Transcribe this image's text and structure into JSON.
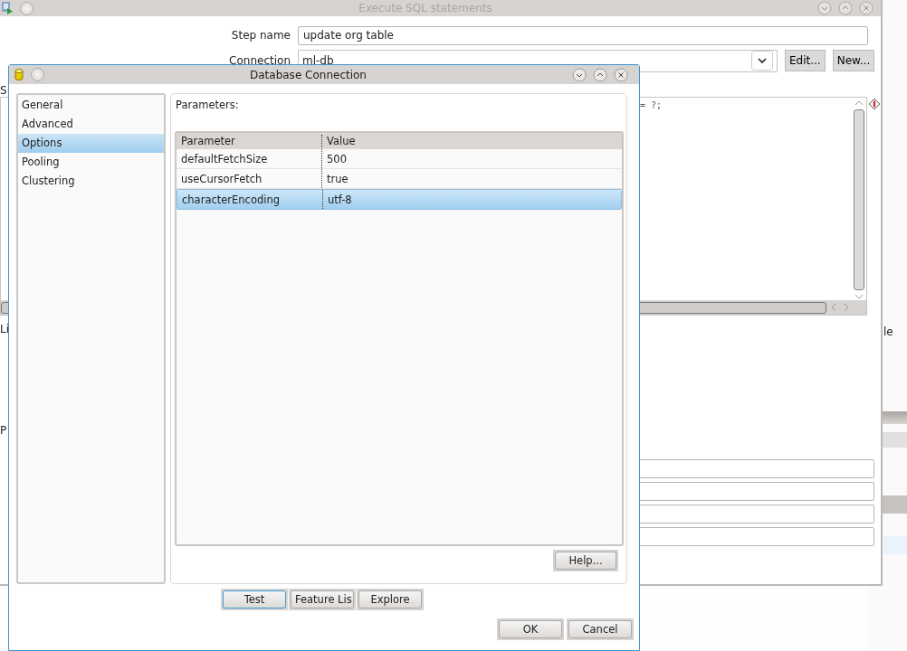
{
  "main_window": {
    "title": "Execute SQL statements",
    "step_name": {
      "label": "Step name",
      "value": "update org table"
    },
    "connection": {
      "label": "Connection",
      "value": "ml-db",
      "buttons": [
        "Edit...",
        "New..."
      ]
    },
    "sql_label": "S",
    "sql_line": "= ?;",
    "labels": [
      "Li",
      "P"
    ]
  },
  "back_window": {
    "text": "le"
  },
  "dialog": {
    "title": "Database Connection",
    "sidebar": [
      {
        "label": "General",
        "selected": false
      },
      {
        "label": "Advanced",
        "selected": false
      },
      {
        "label": "Options",
        "selected": true
      },
      {
        "label": "Pooling",
        "selected": false
      },
      {
        "label": "Clustering",
        "selected": false
      }
    ],
    "parameters_label": "Parameters:",
    "table": {
      "columns": [
        "Parameter",
        "Value"
      ],
      "rows": [
        {
          "cells": [
            "defaultFetchSize",
            "500"
          ],
          "selected": false
        },
        {
          "cells": [
            "useCursorFetch",
            "true"
          ],
          "selected": false
        },
        {
          "cells": [
            "characterEncoding",
            "utf-8"
          ],
          "selected": true
        }
      ]
    },
    "help_button": "Help...",
    "action_buttons": [
      {
        "label": "Test",
        "focused": true
      },
      {
        "label": "Feature Lis",
        "focused": false
      },
      {
        "label": "Explore",
        "focused": false
      }
    ],
    "footer_buttons": [
      "OK",
      "Cancel"
    ]
  }
}
